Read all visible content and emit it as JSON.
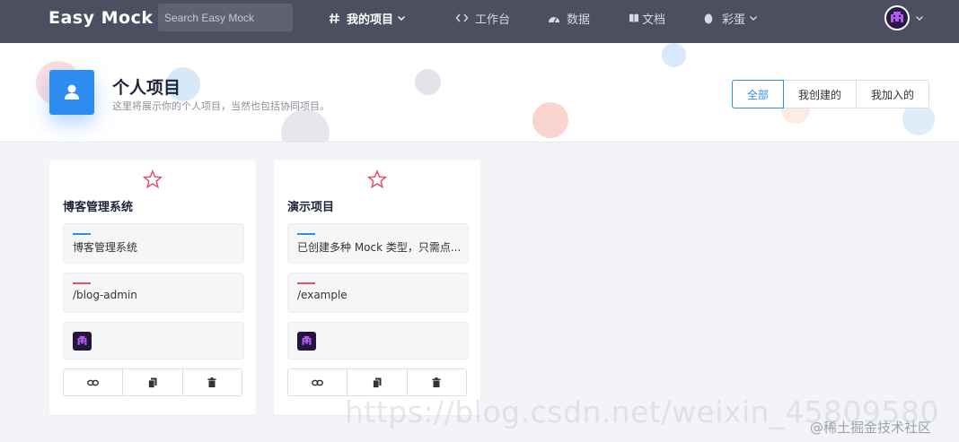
{
  "navbar": {
    "brand": "Easy Mock",
    "search_placeholder": "Search Easy Mock",
    "items": [
      {
        "label": "我的项目",
        "icon": "hash-icon",
        "active": true,
        "dropdown": true
      },
      {
        "label": "工作台",
        "icon": "code-icon",
        "active": false,
        "dropdown": false
      },
      {
        "label": "数据",
        "icon": "dashboard-icon",
        "active": false,
        "dropdown": false
      },
      {
        "label": "文档",
        "icon": "book-icon",
        "active": false,
        "dropdown": false
      },
      {
        "label": "彩蛋",
        "icon": "egg-icon",
        "active": false,
        "dropdown": true
      }
    ],
    "avatar_icon": "pixel-avatar-icon"
  },
  "header": {
    "icon": "user-icon",
    "title": "个人项目",
    "description": "这里将展示你的个人项目，当然也包括协同项目。",
    "filters": [
      "全部",
      "我创建的",
      "我加入的"
    ],
    "active_filter": "全部"
  },
  "projects": [
    {
      "name": "博客管理系统",
      "description": "博客管理系统",
      "url": "/blog-admin"
    },
    {
      "name": "演示项目",
      "description": "已创建多种 Mock 类型，只需点...",
      "url": "/example"
    }
  ],
  "card_actions": [
    "link-icon",
    "copy-icon",
    "trash-icon"
  ],
  "colors": {
    "navbar": "#4c4f5f",
    "primary": "#2d8cf0",
    "description_bar": "#2d8cf0",
    "url_bar": "#ed4f5e",
    "star": "#e1506a"
  },
  "watermarks": {
    "csdn": "https://blog.csdn.net/weixin_45809580",
    "juejin": "@稀土掘金技术社区"
  }
}
